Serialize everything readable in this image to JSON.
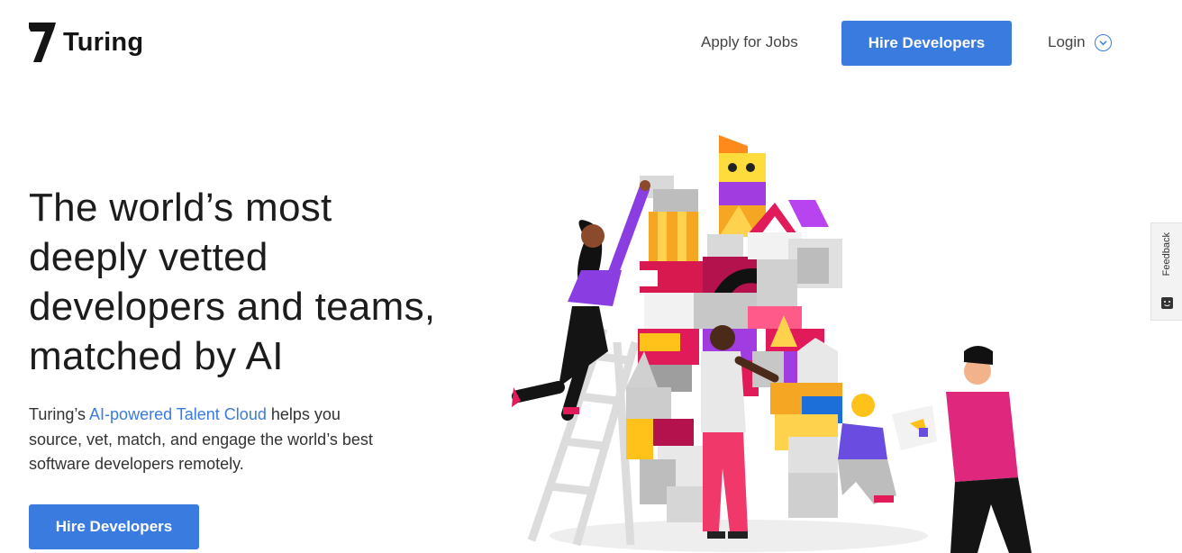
{
  "header": {
    "logo_text": "Turing",
    "nav": {
      "apply_jobs": "Apply for Jobs",
      "hire_developers": "Hire Developers",
      "login": "Login"
    }
  },
  "hero": {
    "title_lines": [
      "The world’s most",
      "deeply vetted",
      "developers and teams,",
      "matched by AI"
    ],
    "description": {
      "before": "Turing’s ",
      "highlight": "AI-powered Talent Cloud",
      "after": " helps you source, vet, match, and engage the world’s best software developers remotely."
    },
    "cta": "Hire Developers"
  },
  "feedback_tab": {
    "label": "Feedback"
  },
  "colors": {
    "accent": "#3a7be0",
    "text_dark": "#1c1c1c"
  },
  "icons": [
    "turing-logo-icon",
    "chevron-down-icon",
    "feedback-icon"
  ]
}
